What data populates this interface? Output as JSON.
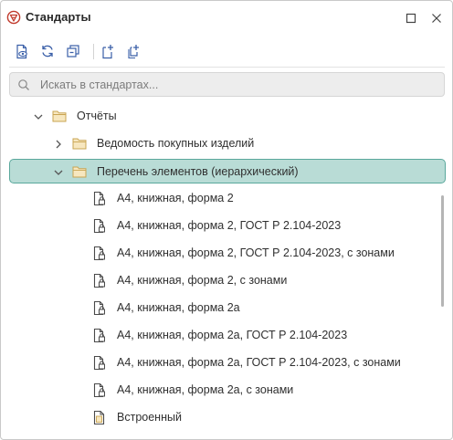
{
  "window": {
    "title": "Стандарты"
  },
  "toolbar": {
    "buttons": [
      {
        "name": "view-standard-button",
        "icon": "doc-eye-icon"
      },
      {
        "name": "refresh-button",
        "icon": "refresh-icon"
      },
      {
        "name": "collapse-all-button",
        "icon": "collapse-icon"
      },
      {
        "name": "add-standard-button",
        "icon": "doc-add-icon"
      },
      {
        "name": "add-copy-button",
        "icon": "doc-copy-add-icon"
      }
    ]
  },
  "search": {
    "placeholder": "Искать в стандартах..."
  },
  "tree": {
    "reports_folder": "Отчёты",
    "purchased_folder": "Ведомость покупных изделий",
    "elements_folder": "Перечень элементов (иерархический)",
    "items": [
      "А4, книжная, форма 2",
      "А4, книжная, форма 2, ГОСТ Р 2.104-2023",
      "А4, книжная, форма 2, ГОСТ Р 2.104-2023, с зонами",
      "А4, книжная, форма 2, с зонами",
      "А4, книжная, форма 2а",
      "А4, книжная, форма 2а, ГОСТ Р 2.104-2023",
      "А4, книжная, форма 2а, ГОСТ Р 2.104-2023, с зонами",
      "А4, книжная, форма 2а, с зонами"
    ],
    "builtin": "Встроенный"
  },
  "colors": {
    "accent": "#c0392b",
    "folder": "#e7c27a",
    "selection_bg": "#b9dcd6",
    "selection_border": "#5aa89c",
    "icon_blue": "#3a5fa8"
  }
}
